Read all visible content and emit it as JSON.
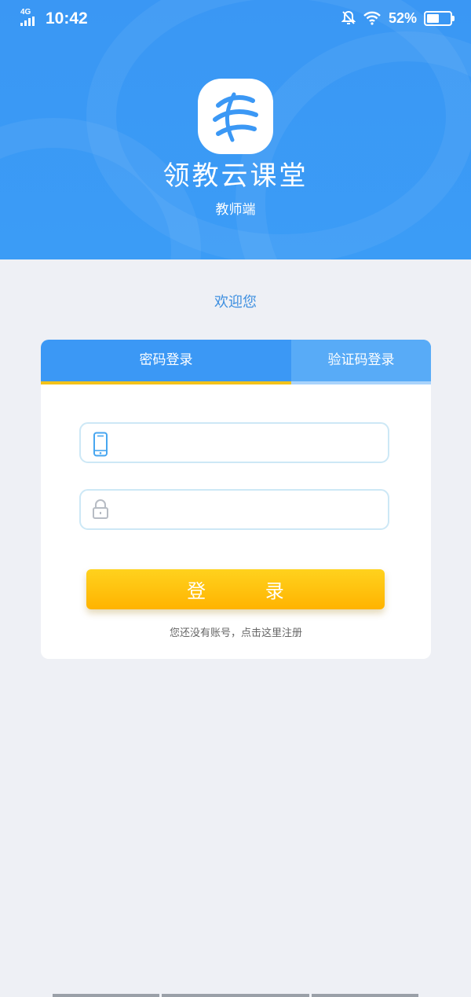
{
  "status_bar": {
    "network": "4G",
    "time": "10:42",
    "battery_percent": "52%",
    "battery_level": 0.52,
    "icons": [
      "signal-bars-icon",
      "bell-mute-icon",
      "wifi-icon",
      "battery-icon"
    ]
  },
  "header": {
    "app_name": "领教云课堂",
    "subtitle": "教师端",
    "accent_color": "#3b98f5",
    "logo_icon": "app-logo-icon"
  },
  "welcome_text": "欢迎您",
  "login_card": {
    "tabs": [
      {
        "label": "密码登录",
        "active": true
      },
      {
        "label": "验证码登录",
        "active": false
      }
    ],
    "phone_field": {
      "value": "",
      "placeholder": "",
      "icon": "phone-icon"
    },
    "password_field": {
      "value": "",
      "placeholder": "",
      "icon": "lock-icon"
    },
    "login_button": "登  录",
    "button_color": "#ffc107",
    "register_link": "您还没有账号，点击这里注册"
  }
}
